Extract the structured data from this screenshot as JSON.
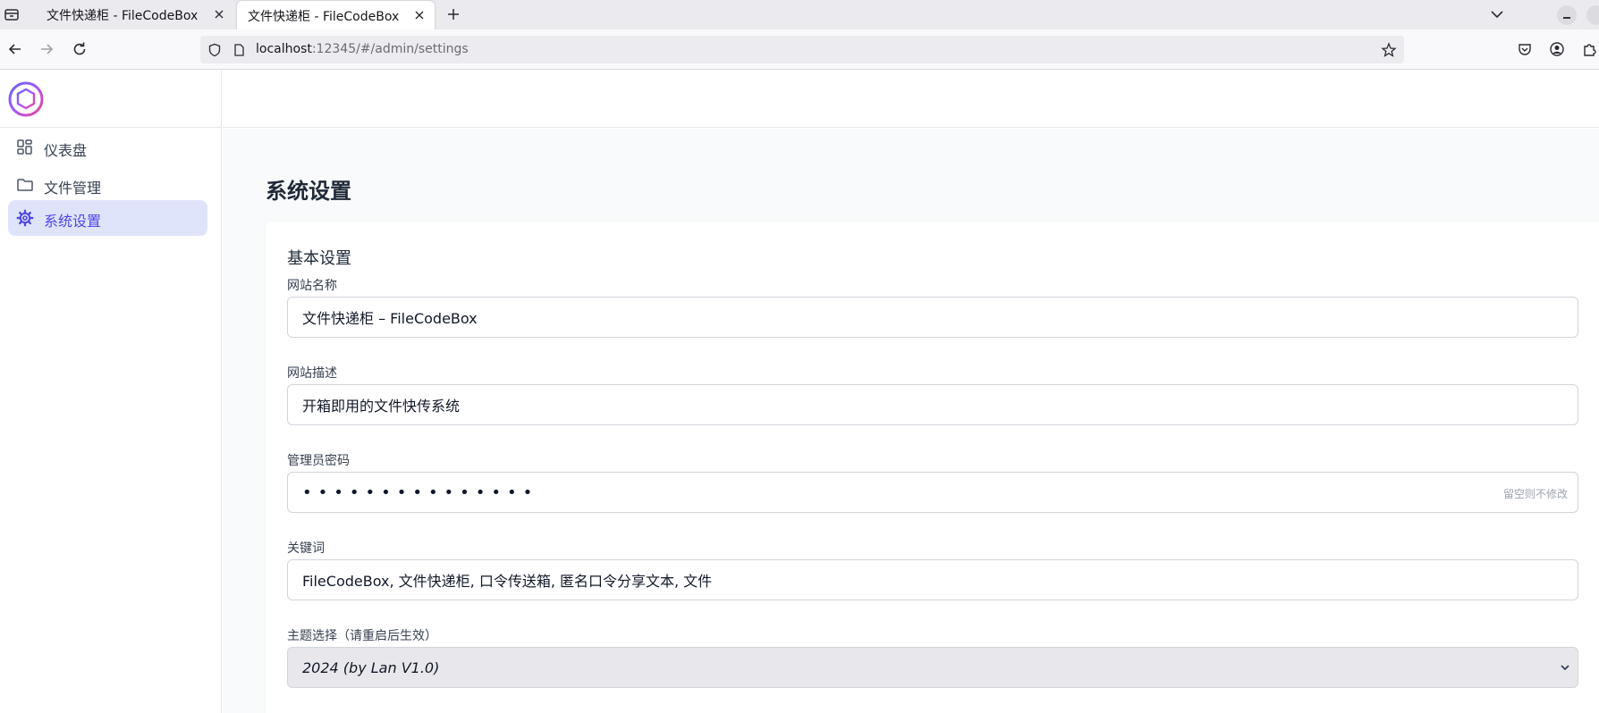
{
  "browser": {
    "tabs": [
      {
        "title": "文件快递柜 - FileCodeBox",
        "active": false
      },
      {
        "title": "文件快递柜 - FileCodeBox",
        "active": true
      }
    ],
    "url_host": "localhost",
    "url_rest": ":12345/#/admin/settings"
  },
  "sidebar": {
    "items": [
      {
        "label": "仪表盘",
        "icon": "dashboard-icon",
        "active": false
      },
      {
        "label": "文件管理",
        "icon": "folder-icon",
        "active": false
      },
      {
        "label": "系统设置",
        "icon": "gear-icon",
        "active": true
      }
    ]
  },
  "main": {
    "page_title": "系统设置",
    "section_title": "基本设置",
    "fields": {
      "site_name": {
        "label": "网站名称",
        "value": "文件快递柜 – FileCodeBox"
      },
      "site_desc": {
        "label": "网站描述",
        "value": "开箱即用的文件快传系统"
      },
      "admin_password": {
        "label": "管理员密码",
        "masked": "•••••••••••••••",
        "hint": "留空则不修改"
      },
      "keywords": {
        "label": "关键词",
        "value": "FileCodeBox, 文件快递柜, 口令传送箱, 匿名口令分享文本, 文件"
      },
      "theme": {
        "label": "主题选择（请重启后生效）",
        "value": "2024 (by Lan V1.0)"
      }
    }
  },
  "colors": {
    "accent": "#4f46e5",
    "active_bg": "#e0e4fb"
  }
}
